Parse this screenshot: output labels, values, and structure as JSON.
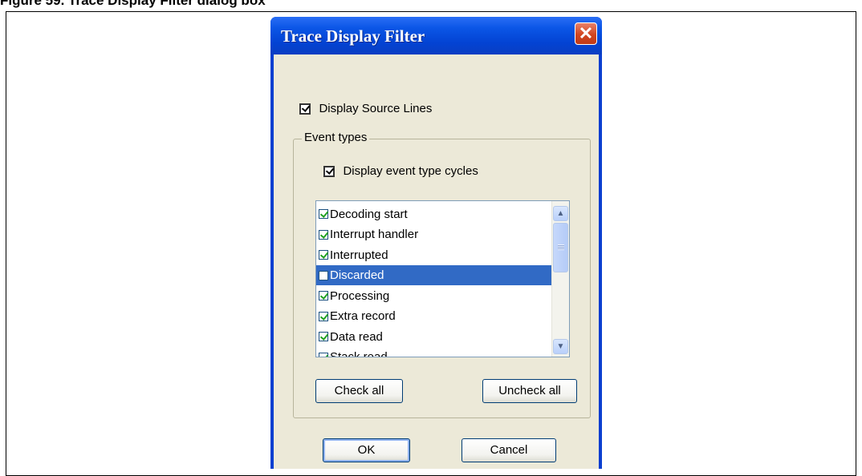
{
  "figure_caption": "Figure 59. Trace Display Filter dialog box",
  "dialog": {
    "title": "Trace Display Filter",
    "close_label": "✕"
  },
  "display_source_lines": {
    "label": "Display Source Lines",
    "checked": true
  },
  "event_types": {
    "legend": "Event types",
    "display_cycles": {
      "label": "Display event type cycles",
      "checked": true
    },
    "items": [
      {
        "label": "Decoding start",
        "checked": true,
        "selected": false
      },
      {
        "label": "Interrupt handler",
        "checked": true,
        "selected": false
      },
      {
        "label": "Interrupted",
        "checked": true,
        "selected": false
      },
      {
        "label": "Discarded",
        "checked": false,
        "selected": true
      },
      {
        "label": "Processing",
        "checked": true,
        "selected": false
      },
      {
        "label": "Extra record",
        "checked": true,
        "selected": false
      },
      {
        "label": "Data read",
        "checked": true,
        "selected": false
      },
      {
        "label": "Stack read",
        "checked": true,
        "selected": false
      }
    ]
  },
  "buttons": {
    "check_all": "Check all",
    "uncheck_all": "Uncheck all",
    "ok": "OK",
    "cancel": "Cancel"
  },
  "colors": {
    "titlebar": "#0343d3",
    "client_bg": "#ece9d8",
    "selection": "#316ac5",
    "close_button": "#d2451f"
  }
}
